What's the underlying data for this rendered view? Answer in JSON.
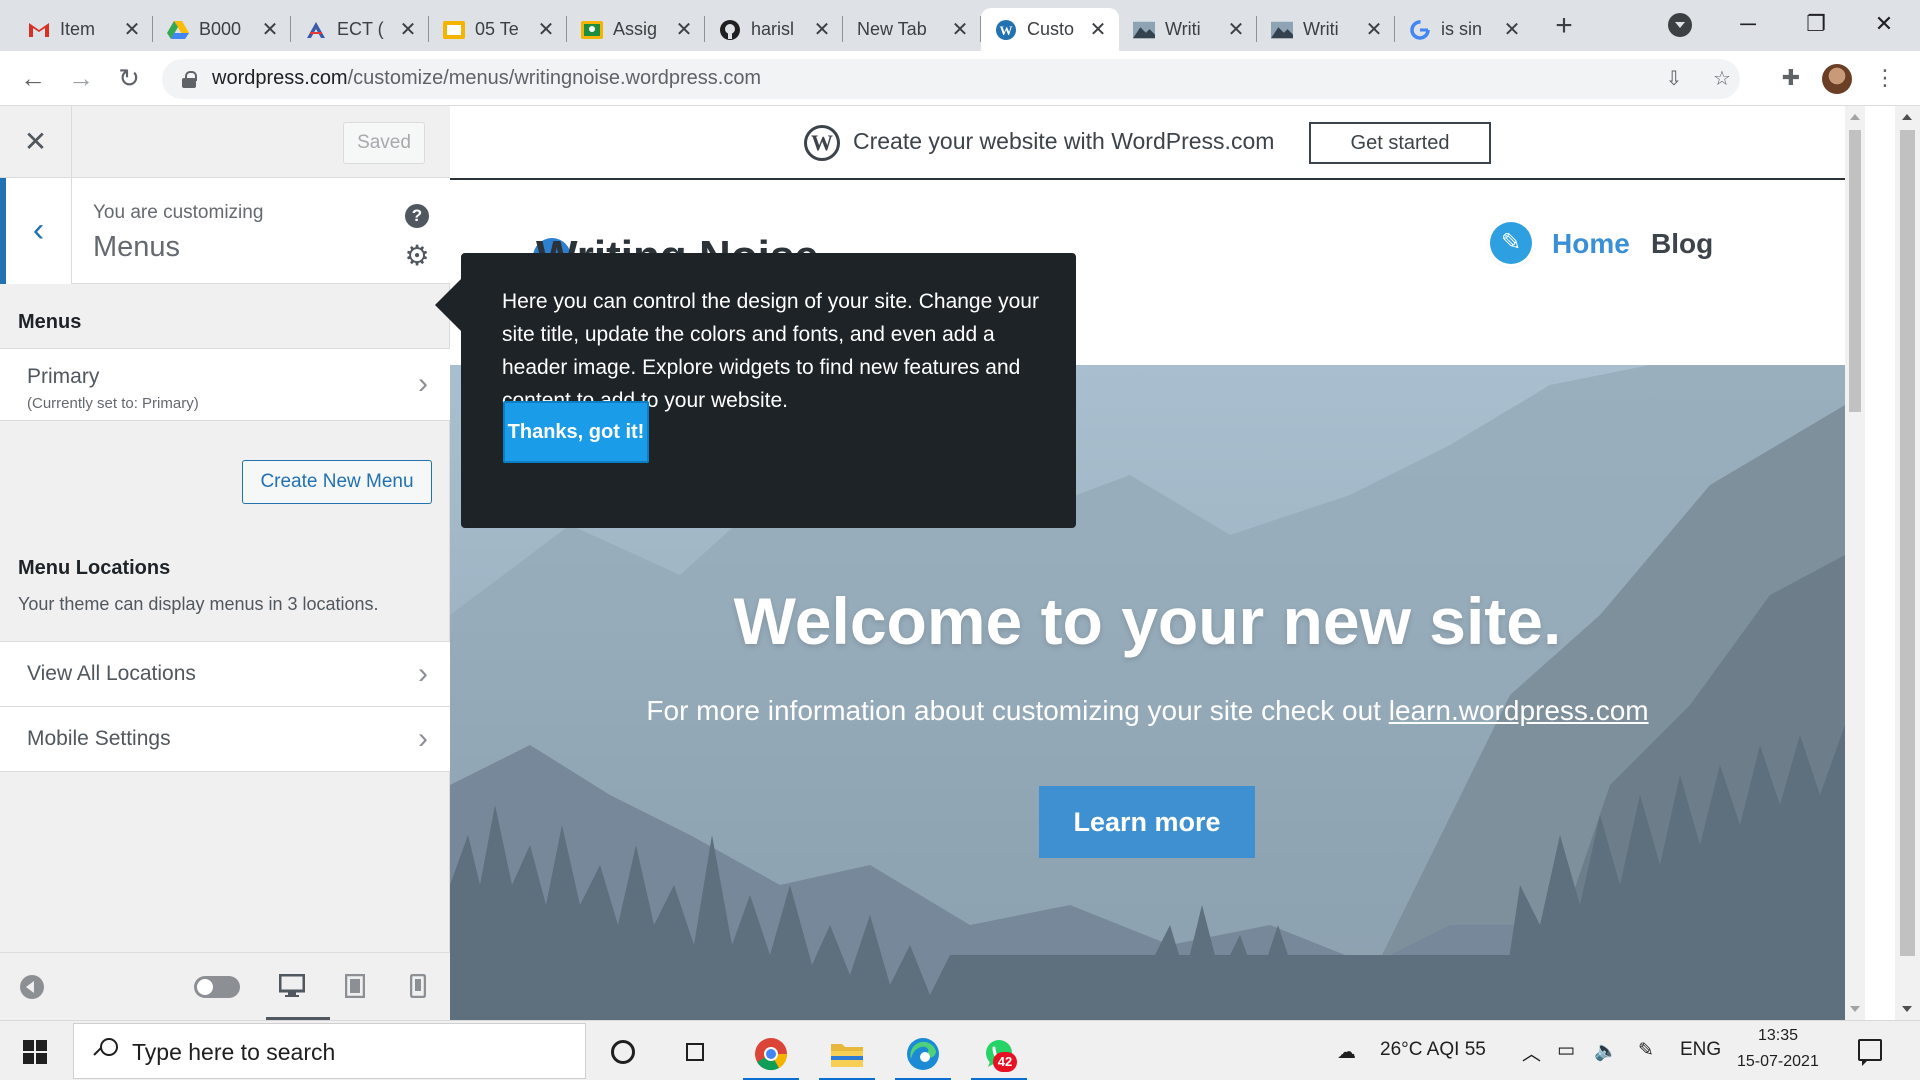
{
  "browser": {
    "tabs": [
      {
        "title": "Item",
        "icon": "gmail-icon",
        "color": "#d93025"
      },
      {
        "title": "B000",
        "icon": "google-drive-icon",
        "color": "#1a73e8"
      },
      {
        "title": "ECT (",
        "icon": "ect-icon",
        "color": "#3b5ba9"
      },
      {
        "title": "05 Te",
        "icon": "slides-icon",
        "color": "#f4b400"
      },
      {
        "title": "Assig",
        "icon": "classroom-icon",
        "color": "#1e8e3e"
      },
      {
        "title": "harisl",
        "icon": "github-icon",
        "color": "#1f1f1f"
      },
      {
        "title": "New Tab",
        "icon": "",
        "color": ""
      },
      {
        "title": "Custo",
        "icon": "wordpress-icon",
        "color": "#2271b1"
      },
      {
        "title": "Writi",
        "icon": "landscape-icon",
        "color": "#4a5a6a"
      },
      {
        "title": "Writi",
        "icon": "landscape-icon",
        "color": "#4a5a6a"
      },
      {
        "title": "is sin",
        "icon": "google-icon",
        "color": "#4285f4"
      }
    ],
    "url_host": "wordpress.com",
    "url_path": "/customize/menus/writingnoise.wordpress.com"
  },
  "sidebar": {
    "saved_label": "Saved",
    "customizing_label": "You are customizing",
    "panel_title": "Menus",
    "menus_heading": "Menus",
    "primary_label": "Primary",
    "primary_sub": "(Currently set to: Primary)",
    "create_menu_label": "Create New Menu",
    "locations_heading": "Menu Locations",
    "locations_desc": "Your theme can display menus in 3 locations.",
    "view_locations_label": "View All Locations",
    "mobile_settings_label": "Mobile Settings"
  },
  "preview": {
    "promo_text": "Create your website with WordPress.com",
    "get_started_label": "Get started",
    "site_title": "Writing Noise",
    "nav": {
      "home": "Home",
      "blog": "Blog"
    },
    "hero_title": "Welcome to your new site.",
    "hero_sub_prefix": "For more information about customizing your site check out ",
    "hero_sub_link": "learn.wordpress.com",
    "learn_more_label": "Learn more",
    "tooltip_text": "Here you can control the design of your site. Change your site title, update the colors and fonts, and even add a header image. Explore widgets to find new features and content to add to your website.",
    "tooltip_button": "Thanks, got it!"
  },
  "taskbar": {
    "search_placeholder": "Type here to search",
    "weather": "26°C  AQI 55",
    "language": "ENG",
    "time": "13:35",
    "date": "15-07-2021",
    "whatsapp_badge": "42"
  }
}
